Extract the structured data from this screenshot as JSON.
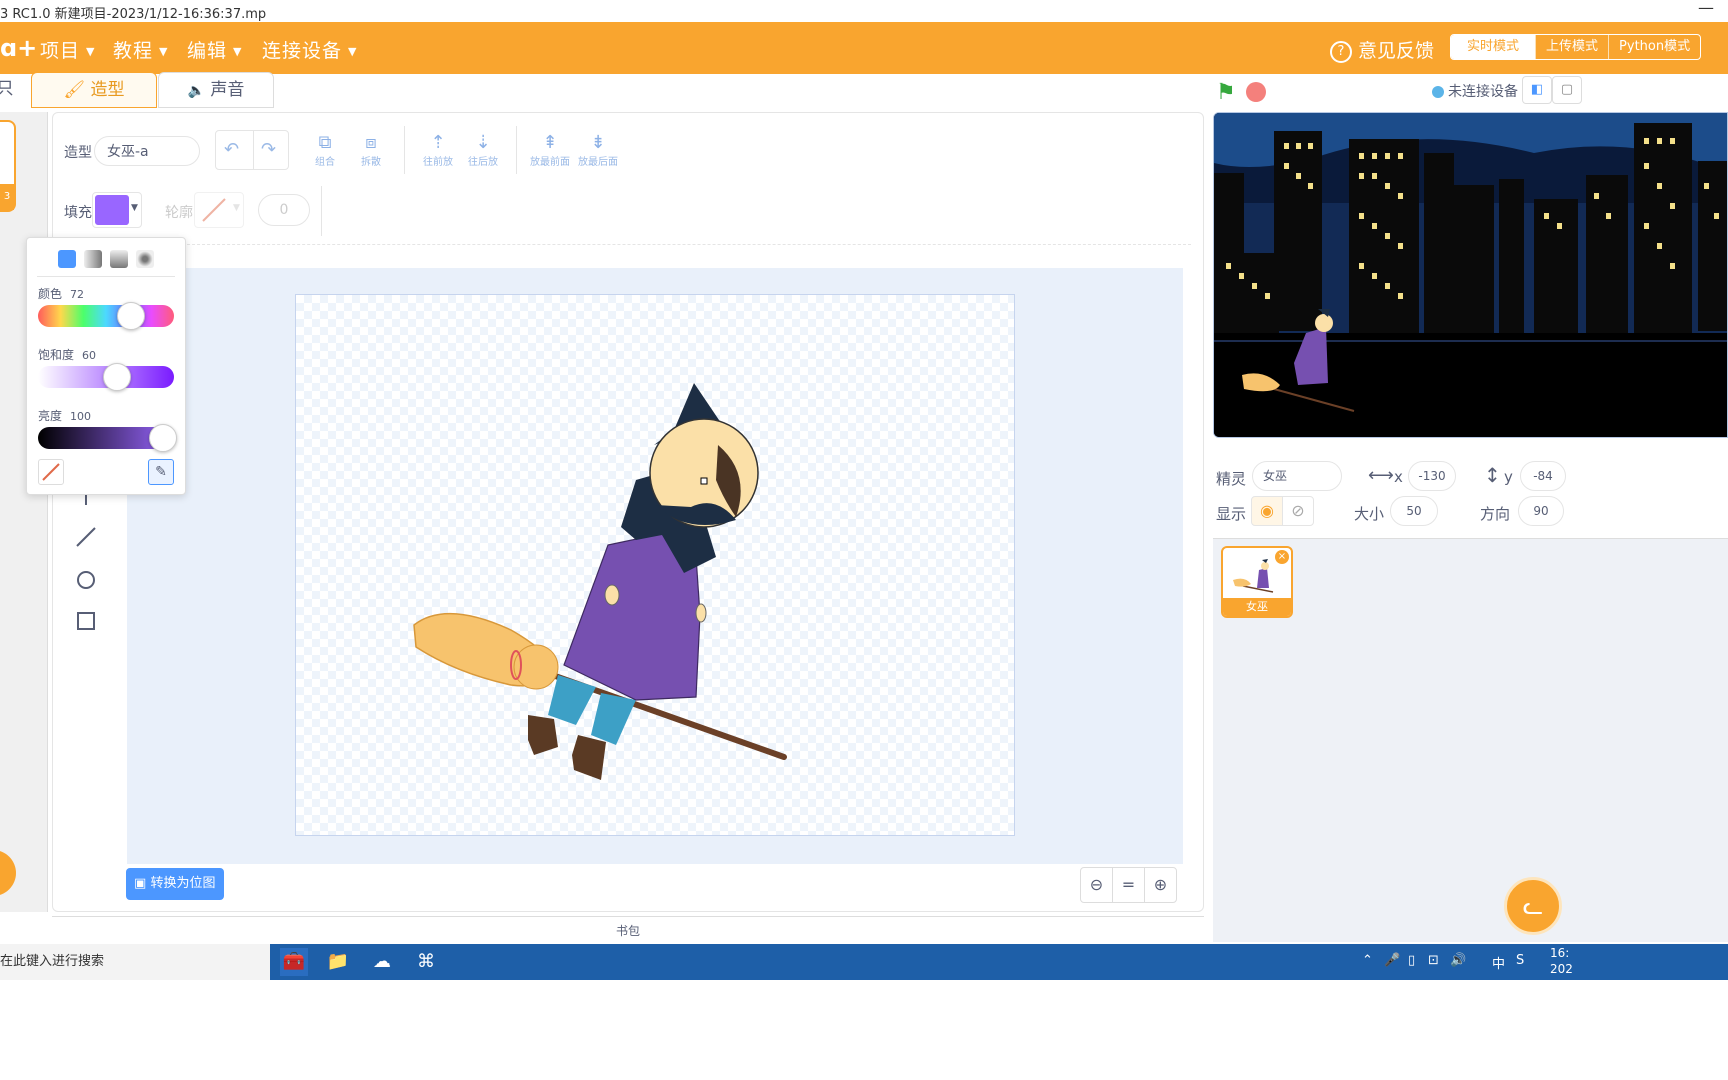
{
  "window": {
    "title": "3 RC1.0   新建项目-2023/1/12-16:36:37.mp",
    "minimize": "—"
  },
  "menubar": {
    "logo": "ɑ+",
    "items": [
      "项目",
      "教程",
      "编辑",
      "连接设备"
    ],
    "feedback": "意见反馈",
    "modes": [
      "实时模式",
      "上传模式",
      "Python模式"
    ]
  },
  "tabs": {
    "code_partial": "只",
    "costume": "造型",
    "sound": "声音"
  },
  "left_sprite_tile_number": "3",
  "editor": {
    "costume_label": "造型",
    "costume_name": "女巫-a",
    "fill_label": "填充",
    "fill_color": "#9966ff",
    "outline_label": "轮廓",
    "outline_width": "0",
    "tools": [
      "组合",
      "拆散",
      "往前放",
      "往后放",
      "放最前面",
      "放最后面"
    ]
  },
  "colorpicker": {
    "hue_label": "颜色",
    "hue": "72",
    "sat_label": "饱和度",
    "sat": "60",
    "bri_label": "亮度",
    "bri": "100"
  },
  "convert_button": "转换为位图",
  "zoom": [
    "⊖",
    "=",
    "⊕"
  ],
  "backpack": "书包",
  "stage": {
    "connection_status": "未连接设备"
  },
  "sprite": {
    "label": "精灵",
    "name": "女巫",
    "x_label": "x",
    "x": "-130",
    "y_label": "y",
    "y": "-84",
    "show_label": "显示",
    "size_label": "大小",
    "size": "50",
    "dir_label": "方向",
    "dir": "90"
  },
  "sprite_list": [
    {
      "name": "女巫"
    }
  ],
  "taskbar": {
    "search_placeholder": "在此键入进行搜索",
    "tray": "中",
    "clock_time": "16:",
    "clock_date": "202"
  },
  "colors": {
    "accent": "#f9a52f",
    "blue": "#4c97ff",
    "fill": "#9966ff"
  }
}
